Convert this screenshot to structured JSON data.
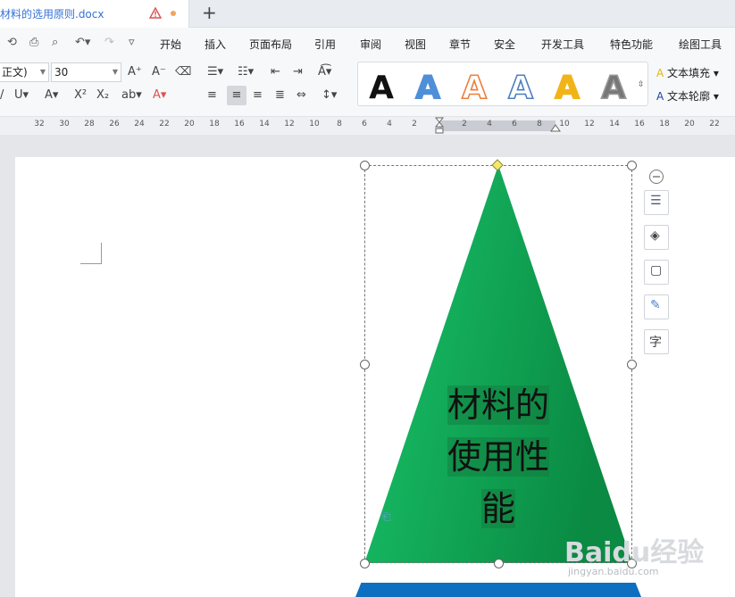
{
  "tab": {
    "title": "材料的选用原则.docx"
  },
  "menus": [
    "开始",
    "插入",
    "页面布局",
    "引用",
    "审阅",
    "视图",
    "章节",
    "安全",
    "开发工具",
    "特色功能",
    "绘图工具"
  ],
  "ribbon": {
    "font_name": "正文)",
    "font_size": "30",
    "word_styles": [
      {
        "label": "A",
        "fill": "#111111",
        "stroke": "#ffffff"
      },
      {
        "label": "A",
        "fill": "#4f8fd8",
        "stroke": "#4f8fd8"
      },
      {
        "label": "A",
        "fill": "#ffffff",
        "stroke": "#ec7f3a"
      },
      {
        "label": "A",
        "fill": "#ffffff",
        "stroke": "#4d7ec0"
      },
      {
        "label": "A",
        "fill": "#f1b418",
        "stroke": "#f1b418"
      },
      {
        "label": "A",
        "fill": "#777777",
        "stroke": "#9a9a9a"
      }
    ],
    "text_fill": "文本填充",
    "text_outline": "文本轮廓"
  },
  "ruler": {
    "ticks": [
      "32",
      "30",
      "28",
      "26",
      "24",
      "22",
      "20",
      "18",
      "16",
      "14",
      "12",
      "10",
      "8",
      "6",
      "4",
      "2",
      "2",
      "4",
      "6",
      "8",
      "10",
      "12",
      "14",
      "16",
      "18",
      "20",
      "22"
    ]
  },
  "shape": {
    "text_lines": [
      "材料的",
      "使用性",
      "能"
    ],
    "gradient_start": "#19c46a",
    "gradient_end": "#0a8a43"
  },
  "watermark": {
    "brand": "Baidu经验",
    "url": "jingyan.baidu.com"
  }
}
